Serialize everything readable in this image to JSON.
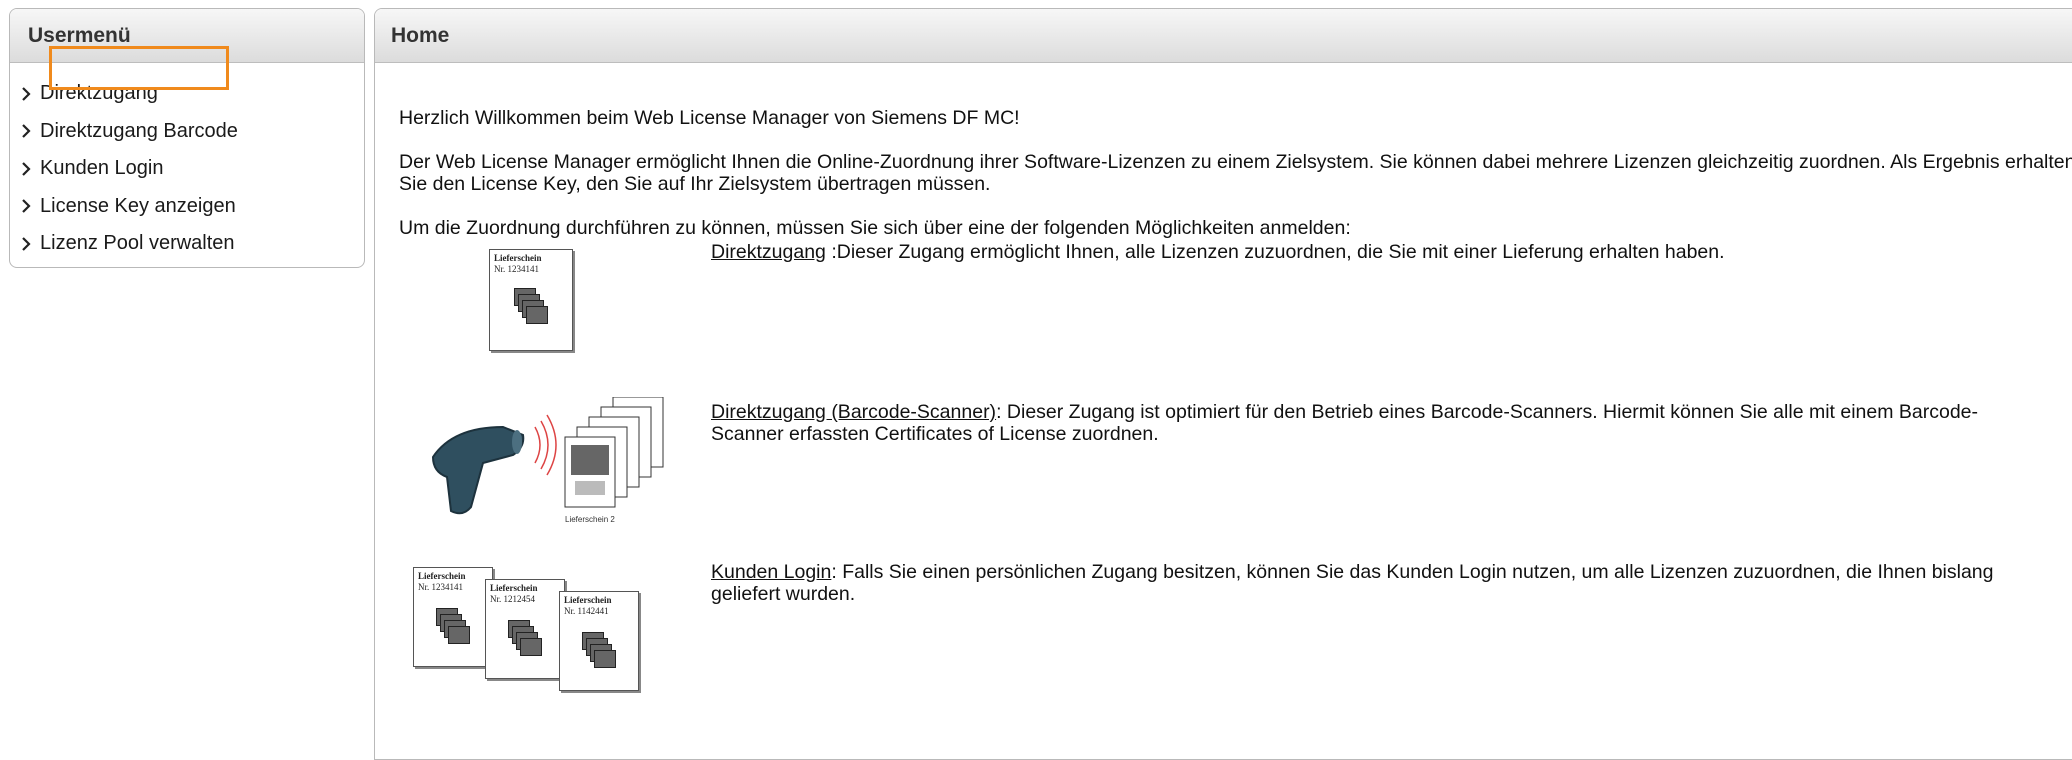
{
  "sidebar": {
    "title": "Usermenü",
    "items": [
      {
        "label": "Direktzugang"
      },
      {
        "label": "Direktzugang Barcode"
      },
      {
        "label": "Kunden Login"
      },
      {
        "label": "License Key anzeigen"
      },
      {
        "label": "Lizenz Pool verwalten"
      }
    ]
  },
  "main": {
    "title": "Home",
    "welcome": "Herzlich Willkommen beim Web License Manager von Siemens DF MC!",
    "description": "Der Web License Manager ermöglicht Ihnen die Online-Zuordnung ihrer Software-Lizenzen zu einem Zielsystem. Sie können dabei mehrere Lizenzen gleichzeitig zuordnen. Als Ergebnis erhalten Sie den License Key, den Sie auf Ihr Zielsystem übertragen müssen.",
    "instruction": "Um die Zuordnung durchführen zu können, müssen Sie sich über eine der folgenden Möglichkeiten anmelden:",
    "options": [
      {
        "link": "Direktzugang",
        "text": " :Dieser Zugang ermöglicht Ihnen, alle Lizenzen zuzuordnen, die Sie mit einer Lieferung erhalten haben.",
        "image_labels": {
          "title": "Lieferschein",
          "number": "Nr. 1234141"
        }
      },
      {
        "link": "Direktzugang (Barcode-Scanner)",
        "text": ": Dieser Zugang ist optimiert für den Betrieb eines Barcode-Scanners. Hiermit können Sie alle mit einem Barcode-Scanner erfassten Certificates of License zuordnen.",
        "image_labels": {
          "caption": "Lieferschein 2"
        }
      },
      {
        "link": "Kunden Login",
        "text": ": Falls Sie einen persönlichen Zugang besitzen, können Sie das Kunden Login nutzen, um alle Lizenzen zuzuordnen, die Ihnen bislang geliefert wurden.",
        "image_labels": [
          {
            "title": "Lieferschein",
            "number": "Nr. 1234141"
          },
          {
            "title": "Lieferschein",
            "number": "Nr. 1212454"
          },
          {
            "title": "Lieferschein",
            "number": "Nr. 1142441"
          }
        ]
      }
    ]
  },
  "colors": {
    "highlight": "#f08a1c",
    "header_gradient_top": "#f7f7f7",
    "header_gradient_bottom": "#dcdcdc",
    "border": "#b9b9b9",
    "scanner": "#2f4f5f"
  }
}
